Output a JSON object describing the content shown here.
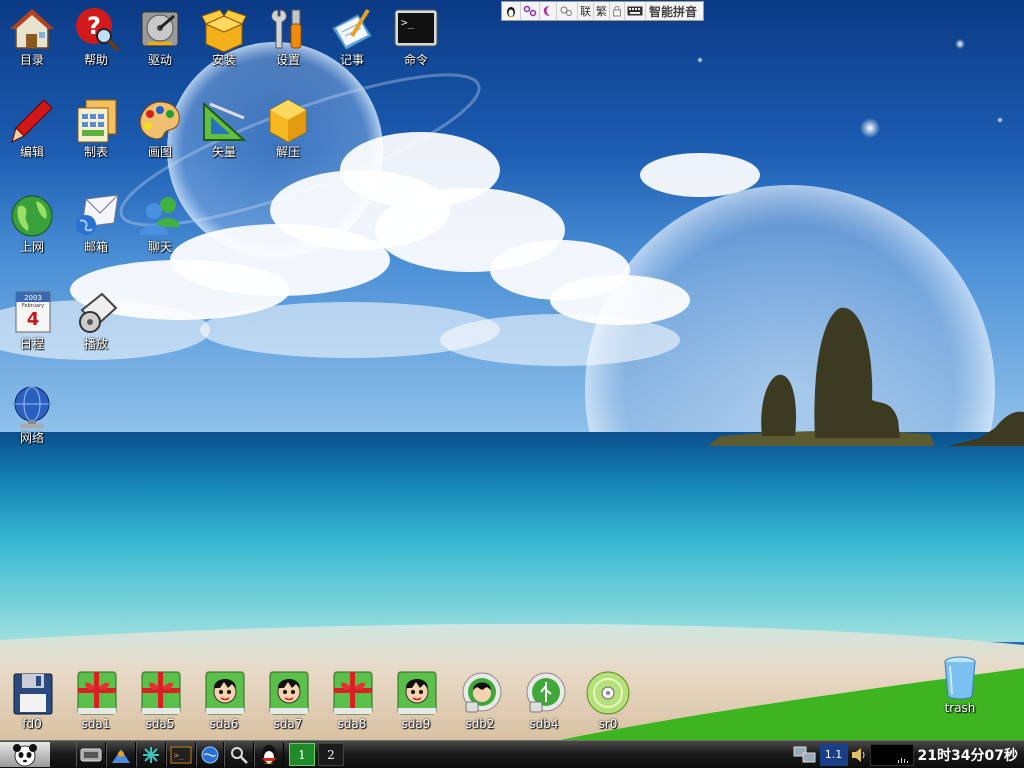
{
  "desktop": {
    "icons": [
      {
        "label": "目录",
        "icon": "home-icon"
      },
      {
        "label": "帮助",
        "icon": "help-icon"
      },
      {
        "label": "驱动",
        "icon": "hard-disk-icon"
      },
      {
        "label": "安装",
        "icon": "package-box-icon"
      },
      {
        "label": "设置",
        "icon": "tools-icon"
      },
      {
        "label": "记事",
        "icon": "notepad-icon"
      },
      {
        "label": "命令",
        "icon": "terminal-icon"
      },
      {
        "label": "编辑",
        "icon": "pen-icon"
      },
      {
        "label": "制表",
        "icon": "spreadsheet-icon"
      },
      {
        "label": "画图",
        "icon": "palette-icon"
      },
      {
        "label": "矢量",
        "icon": "vector-draw-icon"
      },
      {
        "label": "解压",
        "icon": "archive-cube-icon"
      },
      {
        "label": "上网",
        "icon": "globe-icon"
      },
      {
        "label": "邮箱",
        "icon": "mail-icon"
      },
      {
        "label": "聊天",
        "icon": "chat-users-icon"
      },
      {
        "label": "日程",
        "icon": "calendar-icon"
      },
      {
        "label": "播放",
        "icon": "media-player-icon"
      },
      {
        "label": "网络",
        "icon": "network-globe-icon"
      }
    ],
    "calendar_icon": {
      "year": "2003",
      "month": "February",
      "day": "4"
    },
    "drives": [
      {
        "label": "fd0",
        "icon": "floppy-icon"
      },
      {
        "label": "sda1",
        "icon": "drive-gift-icon"
      },
      {
        "label": "sda5",
        "icon": "drive-gift-icon"
      },
      {
        "label": "sda6",
        "icon": "drive-astroboy-icon"
      },
      {
        "label": "sda7",
        "icon": "drive-astroboy-icon"
      },
      {
        "label": "sda8",
        "icon": "drive-gift-icon"
      },
      {
        "label": "sda9",
        "icon": "drive-astroboy-icon"
      },
      {
        "label": "sdb2",
        "icon": "usb-astroboy-icon"
      },
      {
        "label": "sdb4",
        "icon": "usb-drive-icon"
      },
      {
        "label": "sr0",
        "icon": "cdrom-icon"
      }
    ],
    "trash": {
      "label": "trash",
      "icon": "trash-icon"
    }
  },
  "ime": {
    "name": "智能拼音",
    "segments": [
      "linux-penguin-icon",
      "soft-keyboard-symbol-icon",
      "moon-icon",
      "punctuation-icon",
      "联",
      "繁",
      "lock-icon",
      "keyboard-icon"
    ]
  },
  "taskbar": {
    "start_icon": "panda-logo-icon",
    "launchers": [
      "show-desktop-icon",
      "file-manager-icon",
      "network-config-icon",
      "terminal-icon",
      "browser-icon",
      "search-icon",
      "qq-penguin-icon"
    ],
    "workspaces": [
      "1",
      "2"
    ],
    "tray": {
      "network_icon": "network-monitor-icon",
      "kb_indicator": "1.1",
      "volume_icon": "speaker-icon",
      "clock": "21时34分07秒"
    }
  },
  "colors": {
    "accent_green": "#1f8a27",
    "taskbar_dark": "#1c1c1c"
  }
}
